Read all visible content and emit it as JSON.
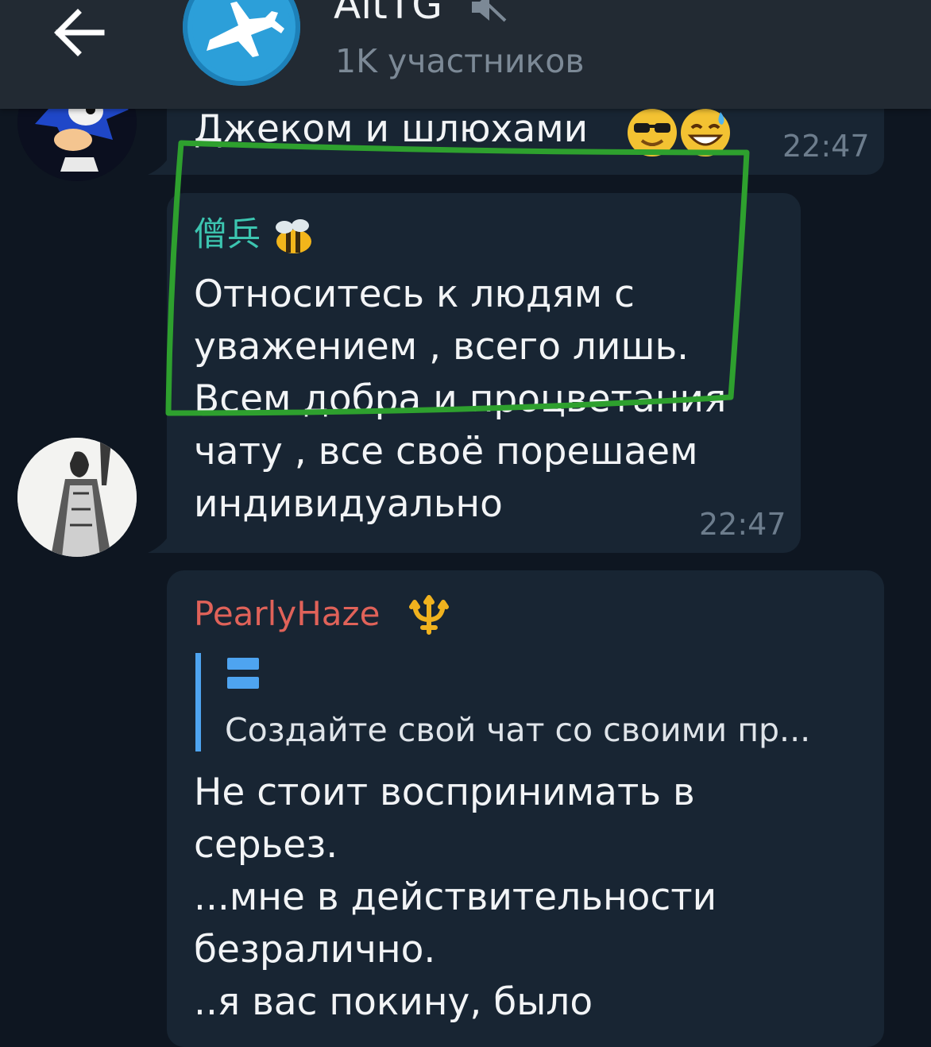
{
  "header": {
    "back_icon": "arrow-left-icon",
    "title": "AltTG",
    "muted_icon": "muted-speaker-icon",
    "subtitle": "1K участников",
    "avatar_icon": "jet-plane-icon"
  },
  "messages": [
    {
      "text": "Джеком и шлюхами",
      "emojis": [
        "smiling-face-with-sunglasses",
        "grinning-face-with-sweat"
      ],
      "time": "22:47"
    },
    {
      "author": "僧兵",
      "author_emoji": "honeybee",
      "author_color": "#3cc5b0",
      "text": "Относитесь к людям с\nуважением , всего лишь.\nВсем добра и процветания\nчату , все своё порешаем\nиндивидуально",
      "time": "22:47"
    },
    {
      "author": "PearlyHaze",
      "author_emoji": "trident",
      "author_color": "#e06259",
      "reply_icon": "equals-sign-icon",
      "reply_text": "Создайте свой чат со своими пр...",
      "text": "Не стоит воспринимать в\nсерьез.\n...мне в действительности\nбезралично.\n..я вас покину, было"
    }
  ],
  "colors": {
    "background": "#0e1621",
    "bubble": "#182533",
    "header": "#222a33",
    "annotation": "#2ea02e",
    "reply_bar": "#4ea4f0"
  }
}
